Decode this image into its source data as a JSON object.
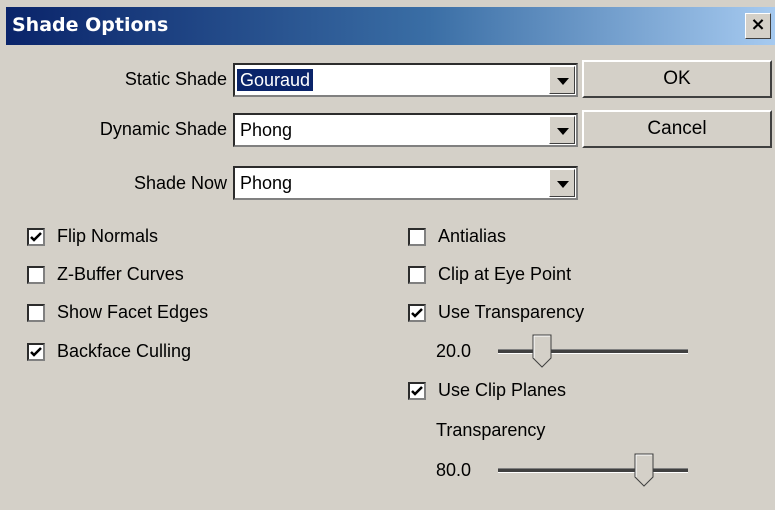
{
  "dialog": {
    "title": "Shade Options",
    "close": "×"
  },
  "fields": {
    "static_shade": {
      "label": "Static Shade",
      "value": "Gouraud"
    },
    "dynamic_shade": {
      "label": "Dynamic Shade",
      "value": "Phong"
    },
    "shade_now": {
      "label": "Shade Now",
      "value": "Phong"
    }
  },
  "buttons": {
    "ok": "OK",
    "cancel": "Cancel"
  },
  "checkboxes": {
    "flip_normals": {
      "label": "Flip Normals",
      "checked": true
    },
    "zbuffer_curves": {
      "label": "Z-Buffer Curves",
      "checked": false
    },
    "show_facet_edges": {
      "label": "Show Facet Edges",
      "checked": false
    },
    "backface_culling": {
      "label": "Backface Culling",
      "checked": true
    },
    "antialias": {
      "label": "Antialias",
      "checked": false
    },
    "clip_eye_point": {
      "label": "Clip at Eye Point",
      "checked": false
    },
    "use_transparency": {
      "label": "Use Transparency",
      "checked": true
    },
    "use_clip_planes": {
      "label": "Use Clip Planes",
      "checked": true
    }
  },
  "sliders": {
    "transparency": {
      "value_text": "20.0",
      "value": 0.2
    },
    "clip_transparency": {
      "label": "Transparency",
      "value_text": "80.0",
      "value": 0.8
    }
  }
}
